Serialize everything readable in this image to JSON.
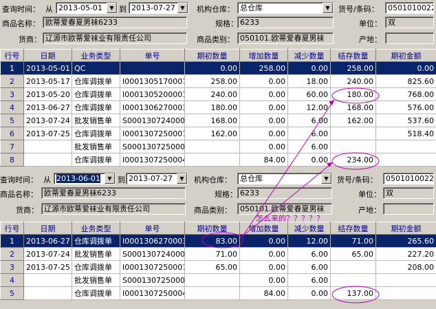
{
  "query": {
    "label_time": "查询时间：",
    "label_from": "从",
    "label_to": "到",
    "label_warehouse": "机构仓库：",
    "label_code": "货号/条码：",
    "label_name": "商品名称：",
    "label_spec": "规格：",
    "label_unit": "单位：",
    "label_supplier": "货商：",
    "label_category": "商品类别：",
    "label_origin": "产地："
  },
  "panel1": {
    "date_from": "2013-05-01",
    "date_to": "2013-07-27",
    "warehouse": "总仓库",
    "code": "0501010022",
    "name": "欧蒂爱春夏男袜6233",
    "spec": "6233",
    "unit": "双",
    "supplier": "辽源市欧蒂爱袜业有限责任公司",
    "category": "050101.欧蒂爱春夏男袜",
    "origin": ""
  },
  "panel2": {
    "date_from": "2013-06-01",
    "date_to": "2013-07-27",
    "warehouse": "总仓库",
    "code": "0501010022",
    "name": "欧蒂爱春夏男袜6233",
    "spec": "6233",
    "unit": "双",
    "supplier": "辽源市欧蒂爱袜业有限责任公司",
    "category": "050101.欧蒂爱春夏男袜",
    "origin": ""
  },
  "grid1": {
    "headers": [
      "行号",
      "日期",
      "业务类型",
      "单号",
      "期初数量",
      "增加数量",
      "减少数量",
      "结存数量",
      "期初金额"
    ],
    "rows": [
      [
        "1",
        "2013-05-01",
        "QC",
        "",
        "0.00",
        "258.00",
        "0.00",
        "258.00",
        "0.00"
      ],
      [
        "2",
        "2013-05-17",
        "仓库调拨单",
        "I0001305170001",
        "258.00",
        "0.00",
        "18.00",
        "240.00",
        "825.60"
      ],
      [
        "3",
        "2013-05-20",
        "仓库调拨单",
        "I0001305200001",
        "240.00",
        "0.00",
        "60.00",
        "180.00",
        "768.00"
      ],
      [
        "4",
        "2013-06-27",
        "仓库调拨单",
        "I0001306270003",
        "180.00",
        "0.00",
        "12.00",
        "168.00",
        "576.00"
      ],
      [
        "5",
        "2013-07-24",
        "批发销售单",
        "S0001307240001",
        "168.00",
        "0.00",
        "6.00",
        "162.00",
        "537.60"
      ],
      [
        "6",
        "2013-07-25",
        "仓库调拨单",
        "I0001307250001",
        "162.00",
        "0.00",
        "6.00",
        "",
        "518.40"
      ],
      [
        "7",
        "",
        "批发销售单",
        "S0001307250001",
        "",
        "0.00",
        "6.00",
        "",
        ""
      ],
      [
        "8",
        "",
        "仓库调拨单",
        "I0001307250004",
        "",
        "84.00",
        "0.00",
        "234.00",
        ""
      ]
    ]
  },
  "grid2": {
    "headers": [
      "行号",
      "日期",
      "业务类型",
      "单号",
      "期初数量",
      "增加数量",
      "减少数量",
      "结存数量",
      "期初金额"
    ],
    "rows": [
      [
        "1",
        "2013-06-27",
        "仓库调拨单",
        "I0001306270003",
        "83.00",
        "0.00",
        "12.00",
        "71.00",
        "265.60"
      ],
      [
        "2",
        "2013-07-24",
        "批发销售单",
        "S0001307240001",
        "71.00",
        "0.00",
        "6.00",
        "65.00",
        "227.20"
      ],
      [
        "3",
        "2013-07-25",
        "仓库调拨单",
        "I0001307250001",
        "65.00",
        "0.00",
        "6.00",
        "",
        "208.00"
      ],
      [
        "4",
        "",
        "批发销售单",
        "S0001307250001",
        "",
        "0.00",
        "6.00",
        "",
        ""
      ],
      [
        "5",
        "",
        "仓库调拨单",
        "I0001307250004",
        "",
        "84.00",
        "0.00",
        "137.00",
        ""
      ]
    ]
  },
  "annotation": {
    "text": "怎么来的？？？？？",
    "color": "#c000c0"
  }
}
